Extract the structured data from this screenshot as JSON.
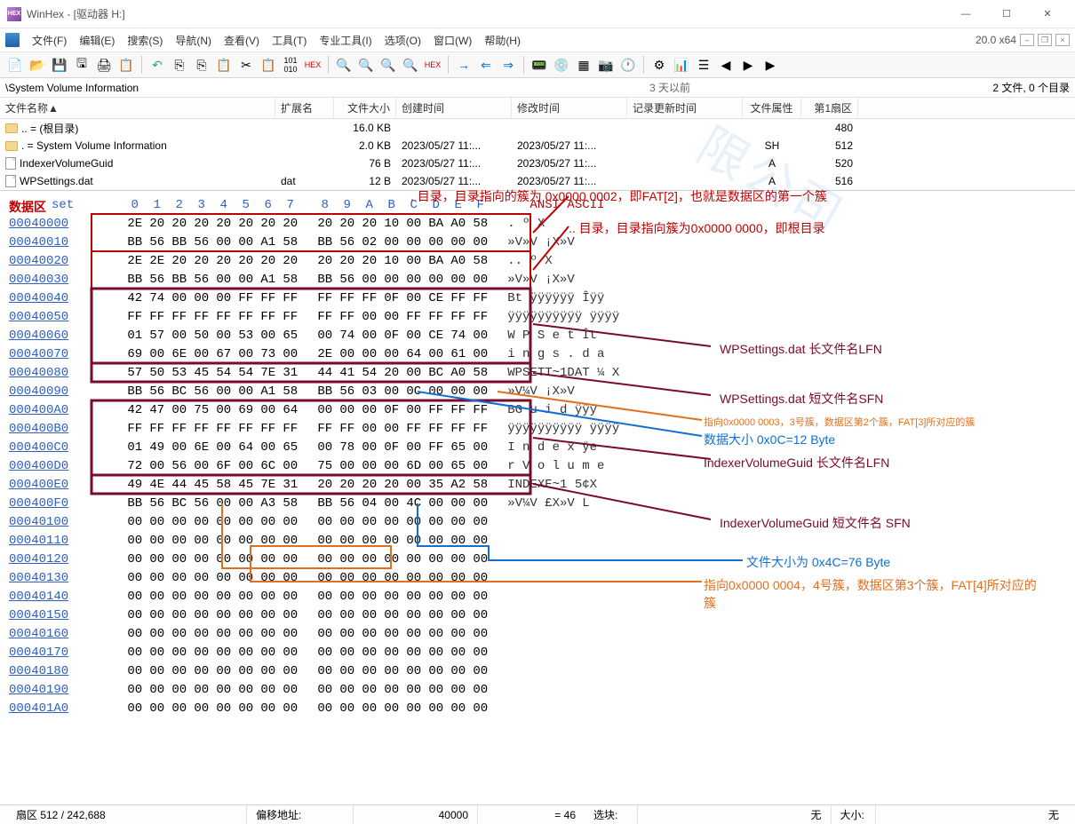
{
  "window": {
    "title": "WinHex - [驱动器 H:]",
    "version": "20.0 x64"
  },
  "menu": {
    "file": "文件(F)",
    "edit": "编辑(E)",
    "search": "搜索(S)",
    "nav": "导航(N)",
    "view": "查看(V)",
    "tools": "工具(T)",
    "expert": "专业工具(I)",
    "options": "选项(O)",
    "window": "窗口(W)",
    "help": "帮助(H)"
  },
  "path": {
    "left": "\\System Volume Information",
    "mid": "3 天以前",
    "right": "2 文件, 0 个目录"
  },
  "cols": {
    "name": "文件名称▲",
    "ext": "扩展名",
    "size": "文件大小",
    "ctime": "创建时间",
    "mtime": "修改时间",
    "rtime": "记录更新时间",
    "attr": "文件属性",
    "sect": "第1扇区"
  },
  "rows": [
    {
      "icon": "folder",
      "name": ".. = (根目录)",
      "ext": "",
      "size": "16.0 KB",
      "ctime": "",
      "mtime": "",
      "attr": "",
      "sect": "480"
    },
    {
      "icon": "folder",
      "name": ". = System Volume Information",
      "ext": "",
      "size": "2.0 KB",
      "ctime": "2023/05/27  11:...",
      "mtime": "2023/05/27  11:...",
      "attr": "SH",
      "sect": "512"
    },
    {
      "icon": "file",
      "name": "IndexerVolumeGuid",
      "ext": "",
      "size": "76 B",
      "ctime": "2023/05/27  11:...",
      "mtime": "2023/05/27  11:...",
      "attr": "A",
      "sect": "520"
    },
    {
      "icon": "file",
      "name": "WPSettings.dat",
      "ext": "dat",
      "size": "12 B",
      "ctime": "2023/05/27  11:...",
      "mtime": "2023/05/27  11:...",
      "attr": "A",
      "sect": "516"
    }
  ],
  "hex": {
    "dataarea": "数据区",
    "offh": "set",
    "asciih": "ANSI ASCII",
    "cols": [
      "0",
      "1",
      "2",
      "3",
      "4",
      "5",
      "6",
      "7",
      "8",
      "9",
      "A",
      "B",
      "C",
      "D",
      "E",
      "F"
    ],
    "lines": [
      {
        "o": "00040000",
        "b": [
          "2E",
          "20",
          "20",
          "20",
          "20",
          "20",
          "20",
          "20",
          "20",
          "20",
          "20",
          "10",
          "00",
          "BA",
          "A0",
          "58"
        ],
        "a": ".          º X"
      },
      {
        "o": "00040010",
        "b": [
          "BB",
          "56",
          "BB",
          "56",
          "00",
          "00",
          "A1",
          "58",
          "BB",
          "56",
          "02",
          "00",
          "00",
          "00",
          "00",
          "00"
        ],
        "a": "»V»V  ¡X»V"
      },
      {
        "o": "00040020",
        "b": [
          "2E",
          "2E",
          "20",
          "20",
          "20",
          "20",
          "20",
          "20",
          "20",
          "20",
          "20",
          "10",
          "00",
          "BA",
          "A0",
          "58"
        ],
        "a": "..         º X"
      },
      {
        "o": "00040030",
        "b": [
          "BB",
          "56",
          "BB",
          "56",
          "00",
          "00",
          "A1",
          "58",
          "BB",
          "56",
          "00",
          "00",
          "00",
          "00",
          "00",
          "00"
        ],
        "a": "»V»V  ¡X»V"
      },
      {
        "o": "00040040",
        "b": [
          "42",
          "74",
          "00",
          "00",
          "00",
          "FF",
          "FF",
          "FF",
          "FF",
          "FF",
          "FF",
          "0F",
          "00",
          "CE",
          "FF",
          "FF"
        ],
        "a": "Bt   ÿÿÿÿÿÿ  Îÿÿ"
      },
      {
        "o": "00040050",
        "b": [
          "FF",
          "FF",
          "FF",
          "FF",
          "FF",
          "FF",
          "FF",
          "FF",
          "FF",
          "FF",
          "00",
          "00",
          "FF",
          "FF",
          "FF",
          "FF"
        ],
        "a": "ÿÿÿÿÿÿÿÿÿÿ  ÿÿÿÿ"
      },
      {
        "o": "00040060",
        "b": [
          "01",
          "57",
          "00",
          "50",
          "00",
          "53",
          "00",
          "65",
          "00",
          "74",
          "00",
          "0F",
          "00",
          "CE",
          "74",
          "00"
        ],
        "a": " W P S e t   Ît"
      },
      {
        "o": "00040070",
        "b": [
          "69",
          "00",
          "6E",
          "00",
          "67",
          "00",
          "73",
          "00",
          "2E",
          "00",
          "00",
          "00",
          "64",
          "00",
          "61",
          "00"
        ],
        "a": "i n g s .   d a"
      },
      {
        "o": "00040080",
        "b": [
          "57",
          "50",
          "53",
          "45",
          "54",
          "54",
          "7E",
          "31",
          "44",
          "41",
          "54",
          "20",
          "00",
          "BC",
          "A0",
          "58"
        ],
        "a": "WPSETT~1DAT  ¼ X"
      },
      {
        "o": "00040090",
        "b": [
          "BB",
          "56",
          "BC",
          "56",
          "00",
          "00",
          "A1",
          "58",
          "BB",
          "56",
          "03",
          "00",
          "0C",
          "00",
          "00",
          "00"
        ],
        "a": "»V¼V  ¡X»V"
      },
      {
        "o": "000400A0",
        "b": [
          "42",
          "47",
          "00",
          "75",
          "00",
          "69",
          "00",
          "64",
          "00",
          "00",
          "00",
          "0F",
          "00",
          "FF",
          "FF",
          "FF"
        ],
        "a": "BG u i d     ÿÿÿ"
      },
      {
        "o": "000400B0",
        "b": [
          "FF",
          "FF",
          "FF",
          "FF",
          "FF",
          "FF",
          "FF",
          "FF",
          "FF",
          "FF",
          "00",
          "00",
          "FF",
          "FF",
          "FF",
          "FF"
        ],
        "a": "ÿÿÿÿÿÿÿÿÿÿ  ÿÿÿÿ"
      },
      {
        "o": "000400C0",
        "b": [
          "01",
          "49",
          "00",
          "6E",
          "00",
          "64",
          "00",
          "65",
          "00",
          "78",
          "00",
          "0F",
          "00",
          "FF",
          "65",
          "00"
        ],
        "a": " I n d e x   ÿe"
      },
      {
        "o": "000400D0",
        "b": [
          "72",
          "00",
          "56",
          "00",
          "6F",
          "00",
          "6C",
          "00",
          "75",
          "00",
          "00",
          "00",
          "6D",
          "00",
          "65",
          "00"
        ],
        "a": "r V o l u   m e"
      },
      {
        "o": "000400E0",
        "b": [
          "49",
          "4E",
          "44",
          "45",
          "58",
          "45",
          "7E",
          "31",
          "20",
          "20",
          "20",
          "20",
          "00",
          "35",
          "A2",
          "58"
        ],
        "a": "INDEXE~1     5¢X"
      },
      {
        "o": "000400F0",
        "b": [
          "BB",
          "56",
          "BC",
          "56",
          "00",
          "00",
          "A3",
          "58",
          "BB",
          "56",
          "04",
          "00",
          "4C",
          "00",
          "00",
          "00"
        ],
        "a": "»V¼V  £X»V  L"
      },
      {
        "o": "00040100",
        "b": [
          "00",
          "00",
          "00",
          "00",
          "00",
          "00",
          "00",
          "00",
          "00",
          "00",
          "00",
          "00",
          "00",
          "00",
          "00",
          "00"
        ],
        "a": ""
      },
      {
        "o": "00040110",
        "b": [
          "00",
          "00",
          "00",
          "00",
          "00",
          "00",
          "00",
          "00",
          "00",
          "00",
          "00",
          "00",
          "00",
          "00",
          "00",
          "00"
        ],
        "a": ""
      },
      {
        "o": "00040120",
        "b": [
          "00",
          "00",
          "00",
          "00",
          "00",
          "00",
          "00",
          "00",
          "00",
          "00",
          "00",
          "00",
          "00",
          "00",
          "00",
          "00"
        ],
        "a": ""
      },
      {
        "o": "00040130",
        "b": [
          "00",
          "00",
          "00",
          "00",
          "00",
          "00",
          "00",
          "00",
          "00",
          "00",
          "00",
          "00",
          "00",
          "00",
          "00",
          "00"
        ],
        "a": ""
      },
      {
        "o": "00040140",
        "b": [
          "00",
          "00",
          "00",
          "00",
          "00",
          "00",
          "00",
          "00",
          "00",
          "00",
          "00",
          "00",
          "00",
          "00",
          "00",
          "00"
        ],
        "a": ""
      },
      {
        "o": "00040150",
        "b": [
          "00",
          "00",
          "00",
          "00",
          "00",
          "00",
          "00",
          "00",
          "00",
          "00",
          "00",
          "00",
          "00",
          "00",
          "00",
          "00"
        ],
        "a": ""
      },
      {
        "o": "00040160",
        "b": [
          "00",
          "00",
          "00",
          "00",
          "00",
          "00",
          "00",
          "00",
          "00",
          "00",
          "00",
          "00",
          "00",
          "00",
          "00",
          "00"
        ],
        "a": ""
      },
      {
        "o": "00040170",
        "b": [
          "00",
          "00",
          "00",
          "00",
          "00",
          "00",
          "00",
          "00",
          "00",
          "00",
          "00",
          "00",
          "00",
          "00",
          "00",
          "00"
        ],
        "a": ""
      },
      {
        "o": "00040180",
        "b": [
          "00",
          "00",
          "00",
          "00",
          "00",
          "00",
          "00",
          "00",
          "00",
          "00",
          "00",
          "00",
          "00",
          "00",
          "00",
          "00"
        ],
        "a": ""
      },
      {
        "o": "00040190",
        "b": [
          "00",
          "00",
          "00",
          "00",
          "00",
          "00",
          "00",
          "00",
          "00",
          "00",
          "00",
          "00",
          "00",
          "00",
          "00",
          "00"
        ],
        "a": ""
      },
      {
        "o": "000401A0",
        "b": [
          "00",
          "00",
          "00",
          "00",
          "00",
          "00",
          "00",
          "00",
          "00",
          "00",
          "00",
          "00",
          "00",
          "00",
          "00",
          "00"
        ],
        "a": ""
      }
    ]
  },
  "ann": {
    "a1": ". 目录，目录指向的簇为 0x0000 0002，即FAT[2]，也就是数据区的第一个簇",
    "a2": ".. 目录，目录指向簇为0x0000 0000，即根目录",
    "a3": "WPSettings.dat 长文件名LFN",
    "a4": "WPSettings.dat 短文件名SFN",
    "a5": "指向0x0000 0003，3号簇，数据区第2个簇，FAT[3]所对应的簇",
    "a6": "数据大小 0x0C=12 Byte",
    "a7": "IndexerVolumeGuid 长文件名LFN",
    "a8": "IndexerVolumeGuid 短文件名 SFN",
    "a9": "文件大小为 0x4C=76 Byte",
    "a10": "指向0x0000 0004，4号簇，数据区第3个簇，FAT[4]所对应的簇"
  },
  "status": {
    "sector": "扇区 512 / 242,688",
    "offlbl": "偏移地址:",
    "offval": "40000",
    "eq": "= 46",
    "sel": "选块:",
    "none1": "无",
    "sizelbl": "大小:",
    "none2": "无"
  },
  "watermark": "限公司"
}
